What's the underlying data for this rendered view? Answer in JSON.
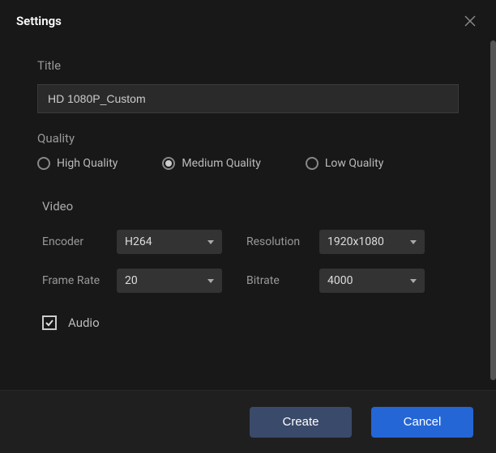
{
  "header": {
    "title": "Settings"
  },
  "title": {
    "label": "Title",
    "value": "HD 1080P_Custom"
  },
  "quality": {
    "label": "Quality",
    "options": {
      "high": "High Quality",
      "medium": "Medium Quality",
      "low": "Low Quality"
    },
    "selected": "medium"
  },
  "video": {
    "label": "Video",
    "encoder": {
      "label": "Encoder",
      "value": "H264"
    },
    "resolution": {
      "label": "Resolution",
      "value": "1920x1080"
    },
    "framerate": {
      "label": "Frame Rate",
      "value": "20"
    },
    "bitrate": {
      "label": "Bitrate",
      "value": "4000"
    }
  },
  "audio": {
    "label": "Audio",
    "checked": true
  },
  "footer": {
    "create": "Create",
    "cancel": "Cancel"
  }
}
